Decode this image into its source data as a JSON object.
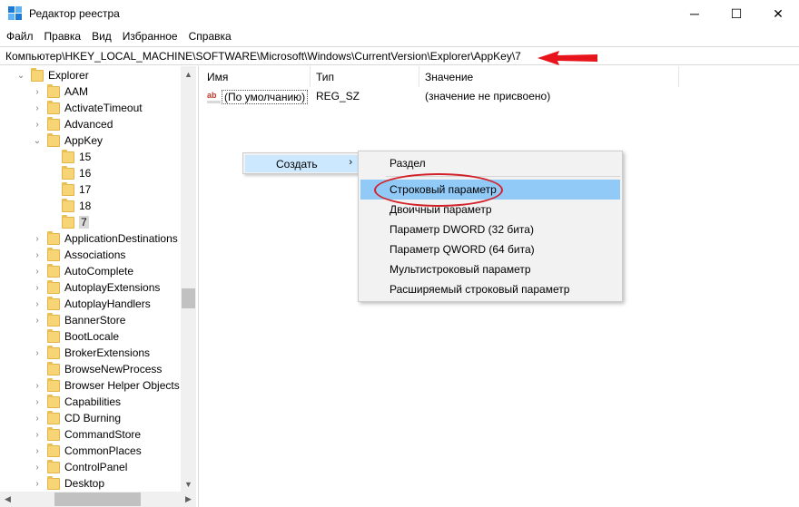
{
  "window": {
    "title": "Редактор реестра",
    "minimize_glyph": "─",
    "maximize_glyph": "☐",
    "close_glyph": "✕"
  },
  "menu": [
    "Файл",
    "Правка",
    "Вид",
    "Избранное",
    "Справка"
  ],
  "address": {
    "path": "Компьютер\\HKEY_LOCAL_MACHINE\\SOFTWARE\\Microsoft\\Windows\\CurrentVersion\\Explorer\\AppKey\\7"
  },
  "tree": {
    "items": [
      {
        "label": "Explorer",
        "expanded": true,
        "icon": "folder-icon"
      },
      {
        "label": "AAM",
        "icon": "folder-icon"
      },
      {
        "label": "ActivateTimeout",
        "icon": "folder-icon"
      },
      {
        "label": "Advanced",
        "icon": "folder-icon"
      },
      {
        "label": "AppKey",
        "expanded": true,
        "icon": "folder-icon"
      },
      {
        "label": "15",
        "icon": "folder-icon"
      },
      {
        "label": "16",
        "icon": "folder-icon"
      },
      {
        "label": "17",
        "icon": "folder-icon"
      },
      {
        "label": "18",
        "icon": "folder-icon"
      },
      {
        "label": "7",
        "selected": true,
        "icon": "folder-icon"
      },
      {
        "label": "ApplicationDestinations",
        "icon": "folder-icon"
      },
      {
        "label": "Associations",
        "icon": "folder-icon"
      },
      {
        "label": "AutoComplete",
        "icon": "folder-icon"
      },
      {
        "label": "AutoplayExtensions",
        "icon": "folder-icon"
      },
      {
        "label": "AutoplayHandlers",
        "icon": "folder-icon"
      },
      {
        "label": "BannerStore",
        "icon": "folder-icon"
      },
      {
        "label": "BootLocale",
        "icon": "folder-icon"
      },
      {
        "label": "BrokerExtensions",
        "icon": "folder-icon"
      },
      {
        "label": "BrowseNewProcess",
        "icon": "folder-icon"
      },
      {
        "label": "Browser Helper Objects",
        "icon": "folder-icon"
      },
      {
        "label": "Capabilities",
        "icon": "folder-icon"
      },
      {
        "label": "CD Burning",
        "icon": "folder-icon"
      },
      {
        "label": "CommandStore",
        "icon": "folder-icon"
      },
      {
        "label": "CommonPlaces",
        "icon": "folder-icon"
      },
      {
        "label": "ControlPanel",
        "icon": "folder-icon"
      },
      {
        "label": "Desktop",
        "icon": "folder-icon"
      }
    ]
  },
  "list": {
    "columns": [
      "Имя",
      "Тип",
      "Значение"
    ],
    "rows": [
      {
        "icon": "string-value-icon",
        "icon_text": "ab",
        "name": "(По умолчанию)",
        "type": "REG_SZ",
        "value": "(значение не присвоено)"
      }
    ]
  },
  "context_menu": {
    "item": "Создать",
    "arrow": "›",
    "submenu": [
      "Раздел",
      "Строковый параметр",
      "Двоичный параметр",
      "Параметр DWORD (32 бита)",
      "Параметр QWORD (64 бита)",
      "Мультистроковый параметр",
      "Расширяемый строковый параметр"
    ]
  },
  "colors": {
    "selection": "#cce8ff",
    "submenu_hover": "#91c9f7",
    "annotation_red": "#d2232a"
  }
}
